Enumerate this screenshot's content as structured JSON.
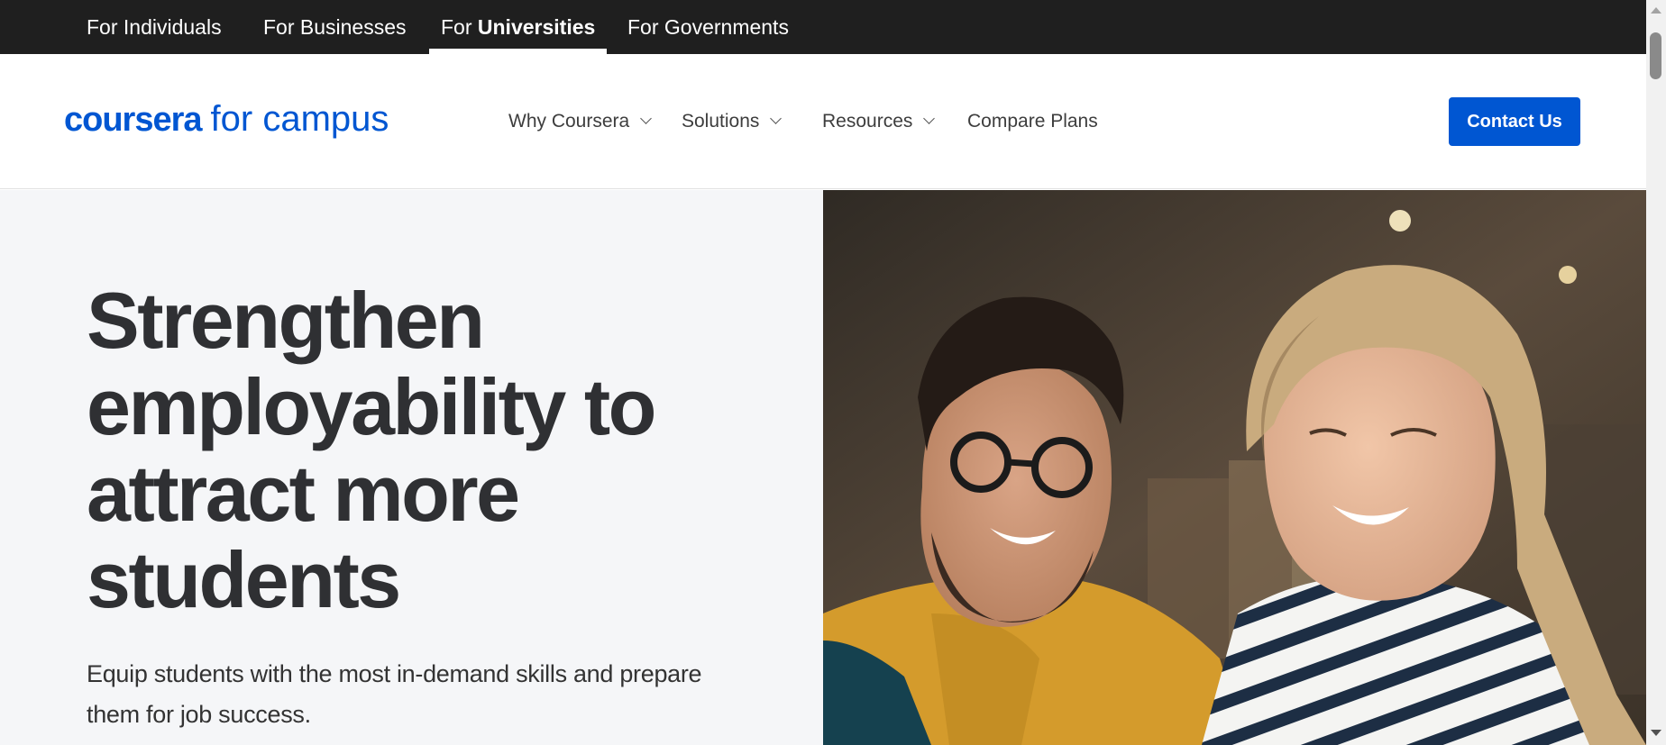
{
  "audience_tabs": [
    {
      "prefix": "For ",
      "bold": "",
      "suffix": "Individuals"
    },
    {
      "prefix": "For ",
      "bold": "",
      "suffix": "Businesses"
    },
    {
      "prefix": "For ",
      "bold": "Universities",
      "suffix": ""
    },
    {
      "prefix": "For ",
      "bold": "",
      "suffix": "Governments"
    }
  ],
  "logo": {
    "brand": "coursera",
    "suffix": "for campus"
  },
  "nav": {
    "items": [
      {
        "label": "Why Coursera"
      },
      {
        "label": "Solutions"
      },
      {
        "label": "Resources"
      },
      {
        "label": "Compare Plans"
      }
    ],
    "contact_label": "Contact Us"
  },
  "hero": {
    "headline_lines": [
      "Strengthen",
      "employability to",
      "attract more",
      "students"
    ],
    "subtext_lines": [
      "Equip students with the most in-demand skills and prepare",
      "them for job success."
    ]
  },
  "colors": {
    "brand_blue": "#0056d2",
    "topbar_bg": "#1f1f1f",
    "hero_bg": "#f5f6f8",
    "headline": "#2f3033"
  },
  "icons": {
    "nav_chevron": "chevron-down-icon",
    "scroll_up": "scroll-up-arrow-icon",
    "scroll_down": "scroll-down-arrow-icon"
  }
}
